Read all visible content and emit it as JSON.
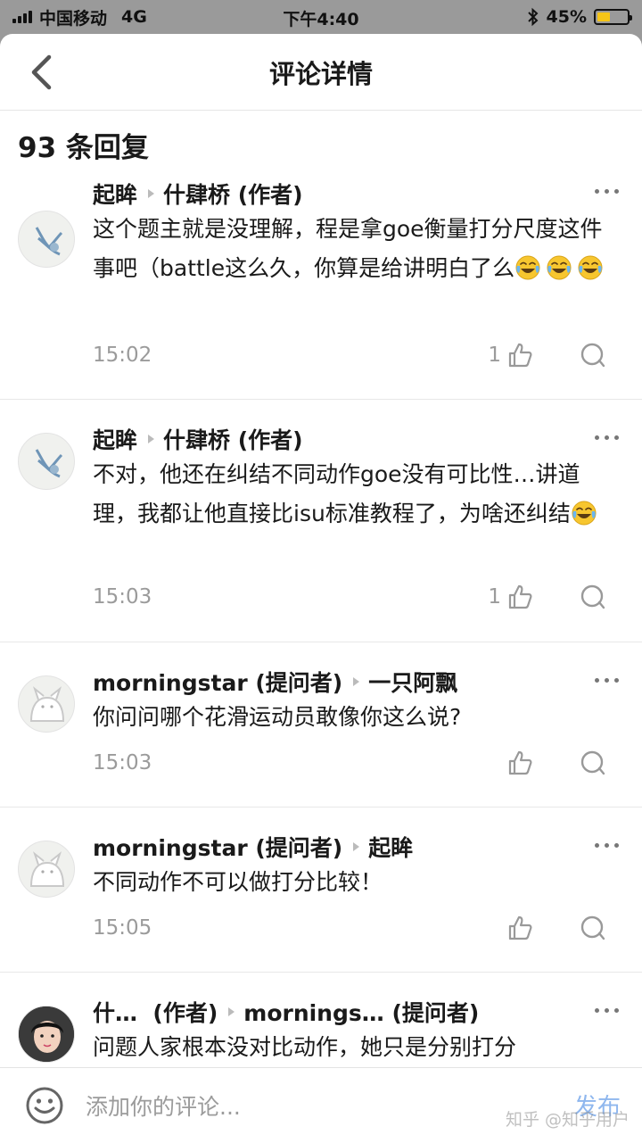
{
  "status_bar": {
    "carrier": "中国移动",
    "network": "4G",
    "time": "下午4:40",
    "battery_percent": "45%",
    "battery_level": 0.45
  },
  "nav": {
    "title": "评论详情"
  },
  "reply_count": "93 条回复",
  "comments": [
    {
      "author": "起眸",
      "reply_to": "什肆桥 (作者)",
      "text": "这个题主就是没理解，程是拿goe衡量打分尺度这件事吧（battle这么久，你算是给讲明白了么",
      "emoji_count": 3,
      "time": "15:02",
      "likes": "1"
    },
    {
      "author": "起眸",
      "reply_to": "什肆桥 (作者)",
      "text": "不对，他还在纠结不同动作goe没有可比性…讲道理，我都让他直接比isu标准教程了，为啥还纠结",
      "emoji_count": 1,
      "time": "15:03",
      "likes": "1"
    },
    {
      "author": "morningstar (提问者)",
      "reply_to": "一只阿飘",
      "text": "你问问哪个花滑运动员敢像你这么说?",
      "time": "15:03",
      "likes": ""
    },
    {
      "author": "morningstar (提问者)",
      "reply_to": "起眸",
      "text": "不同动作不可以做打分比较！",
      "time": "15:05",
      "likes": ""
    },
    {
      "author": "什…  (作者)",
      "reply_to": "mornings… (提问者)",
      "text": "问题人家根本没对比动作，她只是分别打分"
    }
  ],
  "input": {
    "placeholder": "添加你的评论...",
    "publish": "发布"
  },
  "watermark": "知乎 @知乎用户"
}
